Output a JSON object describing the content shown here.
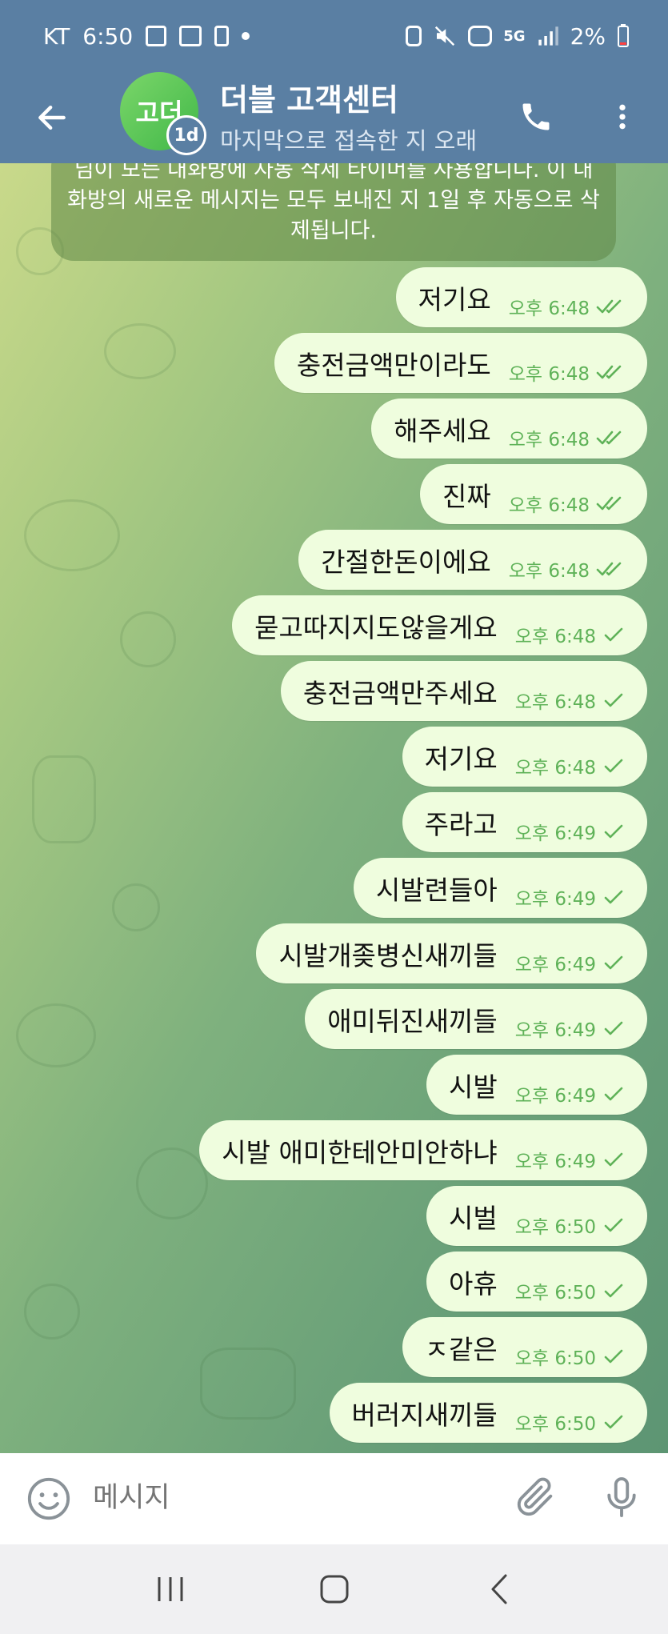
{
  "status_bar": {
    "carrier": "KT",
    "time": "6:50",
    "battery": "2%",
    "network": "5G"
  },
  "header": {
    "avatar_text": "고더",
    "timer_badge": "1d",
    "title": "더블 고객센터",
    "subtitle": "마지막으로 접속한 지 오래"
  },
  "service_message": "님이 모든 대화방에 자동 삭제 타이머를 사용합니다. 이 대화방의 새로운 메시지는 모두 보내진 지 1일 후 자동으로 삭제됩니다.",
  "messages": [
    {
      "text": "저기요",
      "time": "오후 6:48",
      "status": "read"
    },
    {
      "text": "충전금액만이라도",
      "time": "오후 6:48",
      "status": "read"
    },
    {
      "text": "해주세요",
      "time": "오후 6:48",
      "status": "read"
    },
    {
      "text": "진짜",
      "time": "오후 6:48",
      "status": "read"
    },
    {
      "text": "간절한돈이에요",
      "time": "오후 6:48",
      "status": "read"
    },
    {
      "text": "묻고따지지도않을게요",
      "time": "오후 6:48",
      "status": "sent"
    },
    {
      "text": "충전금액만주세요",
      "time": "오후 6:48",
      "status": "sent"
    },
    {
      "text": "저기요",
      "time": "오후 6:48",
      "status": "sent"
    },
    {
      "text": "주라고",
      "time": "오후 6:49",
      "status": "sent"
    },
    {
      "text": "시발련들아",
      "time": "오후 6:49",
      "status": "sent"
    },
    {
      "text": "시발개좆병신새끼들",
      "time": "오후 6:49",
      "status": "sent"
    },
    {
      "text": "애미뒤진새끼들",
      "time": "오후 6:49",
      "status": "sent"
    },
    {
      "text": "시발",
      "time": "오후 6:49",
      "status": "sent"
    },
    {
      "text": "시발 애미한테안미안하냐",
      "time": "오후 6:49",
      "status": "sent"
    },
    {
      "text": "시벌",
      "time": "오후 6:50",
      "status": "sent"
    },
    {
      "text": "아휴",
      "time": "오후 6:50",
      "status": "sent"
    },
    {
      "text": "ㅈ같은",
      "time": "오후 6:50",
      "status": "sent"
    },
    {
      "text": "버러지새끼들",
      "time": "오후 6:50",
      "status": "sent"
    }
  ],
  "input": {
    "placeholder": "메시지"
  },
  "colors": {
    "header_bg": "#5a7fa3",
    "bubble_bg": "#effdde",
    "time_color": "#5fb258"
  },
  "icons": {
    "back": "arrow-left-icon",
    "call": "phone-icon",
    "menu": "more-vertical-icon",
    "emoji": "smile-icon",
    "attach": "paperclip-icon",
    "mic": "microphone-icon"
  }
}
